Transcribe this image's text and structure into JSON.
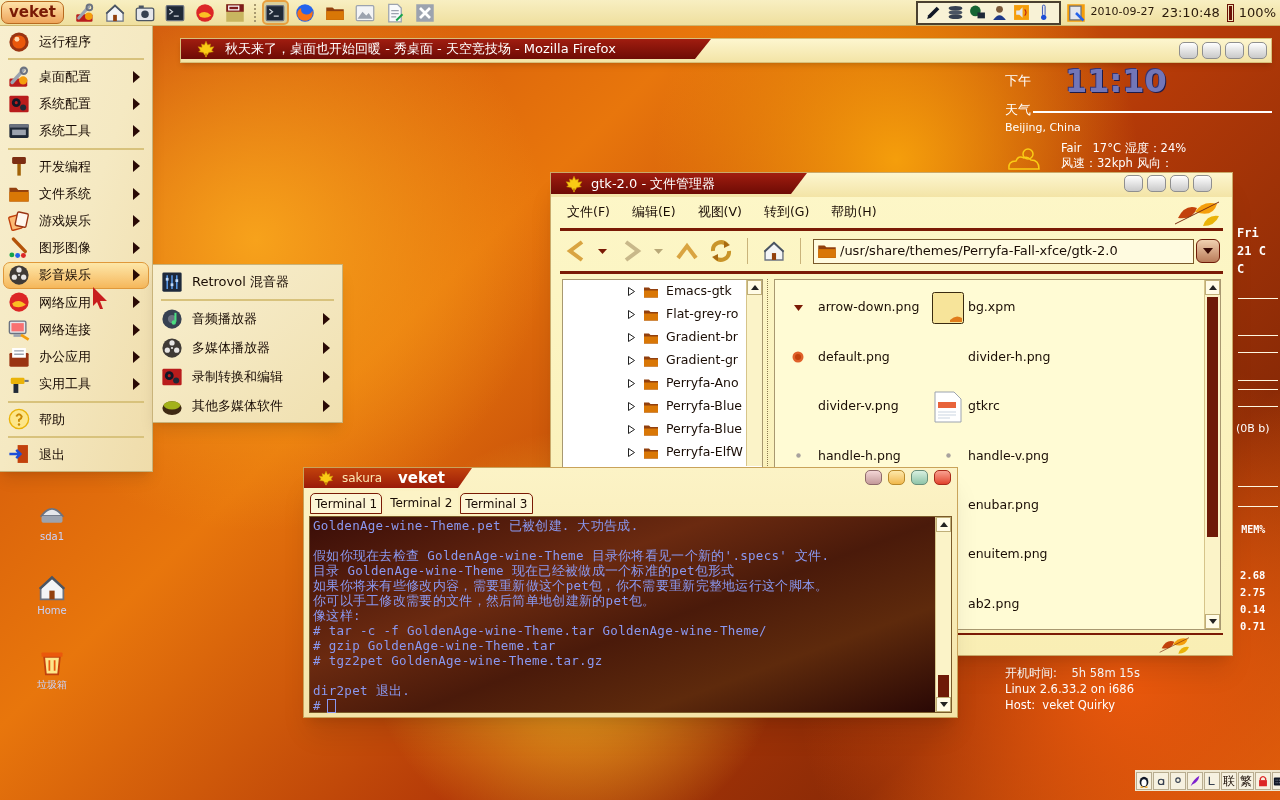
{
  "top_panel": {
    "start_button": "veket",
    "launchers": [
      {
        "active": false
      },
      {
        "active": false
      },
      {
        "active": false
      },
      {
        "active": false
      },
      {
        "active": false
      },
      {
        "active": false
      },
      {
        "active": true
      },
      {
        "active": false
      },
      {
        "active": false
      },
      {
        "active": false
      },
      {
        "active": false
      },
      {
        "active": false
      }
    ],
    "date": "2010-09-27",
    "time": "23:10:48",
    "battery_reading": "100%"
  },
  "browser_window": {
    "title": "秋天来了，桌面也开始回暖 - 秀桌面 - 天空竞技场 - Mozilla Firefox"
  },
  "conky": {
    "period": "下午",
    "clock": "11:10",
    "weather_heading": "天气",
    "location": "Beijing, China",
    "conditions": "Fair   17°C 湿度：24%",
    "wind": "风速：32kph 风向：",
    "forecast": [
      "Fri",
      "21 C",
      "C"
    ],
    "traffic": "(0B b)",
    "mem_heading": "MEM%",
    "mem_values": [
      "2.68",
      "2.75",
      "0.14",
      "0.71"
    ],
    "uptime": "开机时间:    5h 58m 15s",
    "kernel": "Linux 2.6.33.2 on i686",
    "host": "Host:  veket Quirky"
  },
  "menu": {
    "items": [
      {
        "kind": "item",
        "label": "运行程序",
        "submenu": false,
        "selected": false
      },
      {
        "kind": "separator"
      },
      {
        "kind": "item",
        "label": "桌面配置",
        "submenu": true,
        "selected": false
      },
      {
        "kind": "item",
        "label": "系统配置",
        "submenu": true,
        "selected": false
      },
      {
        "kind": "item",
        "label": "系统工具",
        "submenu": true,
        "selected": false
      },
      {
        "kind": "separator"
      },
      {
        "kind": "item",
        "label": "开发编程",
        "submenu": true,
        "selected": false
      },
      {
        "kind": "item",
        "label": "文件系统",
        "submenu": true,
        "selected": false
      },
      {
        "kind": "item",
        "label": "游戏娱乐",
        "submenu": true,
        "selected": false
      },
      {
        "kind": "item",
        "label": "图形图像",
        "submenu": true,
        "selected": false
      },
      {
        "kind": "item",
        "label": "影音娱乐",
        "submenu": true,
        "selected": true
      },
      {
        "kind": "item",
        "label": "网络应用",
        "submenu": true,
        "selected": false
      },
      {
        "kind": "item",
        "label": "网络连接",
        "submenu": true,
        "selected": false
      },
      {
        "kind": "item",
        "label": "办公应用",
        "submenu": true,
        "selected": false
      },
      {
        "kind": "item",
        "label": "实用工具",
        "submenu": true,
        "selected": false
      },
      {
        "kind": "separator"
      },
      {
        "kind": "item",
        "label": "帮助",
        "submenu": false,
        "selected": false
      },
      {
        "kind": "separator"
      },
      {
        "kind": "item",
        "label": "退出",
        "submenu": false,
        "selected": false
      }
    ]
  },
  "submenu": {
    "items": [
      {
        "kind": "item",
        "label": "Retrovol 混音器",
        "submenu": false
      },
      {
        "kind": "separator"
      },
      {
        "kind": "item",
        "label": "音频播放器",
        "submenu": true
      },
      {
        "kind": "item",
        "label": "多媒体播放器",
        "submenu": true
      },
      {
        "kind": "item",
        "label": "录制转换和编辑",
        "submenu": true
      },
      {
        "kind": "item",
        "label": "其他多媒体软件",
        "submenu": true
      }
    ]
  },
  "file_manager": {
    "title": "gtk-2.0 - 文件管理器",
    "menus": [
      "文件(F)",
      "编辑(E)",
      "视图(V)",
      "转到(G)",
      "帮助(H)"
    ],
    "location": "/usr/share/themes/Perryfa-Fall-xfce/gtk-2.0",
    "tree": [
      {
        "label": "Emacs-gtk",
        "expanded": false
      },
      {
        "label": "Flat-grey-ro",
        "expanded": false
      },
      {
        "label": "Gradient-br",
        "expanded": false
      },
      {
        "label": "Gradient-gr",
        "expanded": false
      },
      {
        "label": "Perryfa-Ano",
        "expanded": false
      },
      {
        "label": "Perryfa-Blue",
        "expanded": false
      },
      {
        "label": "Perryfa-Blue",
        "expanded": false
      },
      {
        "label": "Perryfa-ElfW",
        "expanded": false
      }
    ],
    "file_rows": [
      {
        "left": "arrow-down.png",
        "right": "bg.xpm"
      },
      {
        "left": "default.png",
        "right": "divider-h.png"
      },
      {
        "left": "divider-v.png",
        "right": "gtkrc"
      },
      {
        "left": "handle-h.png",
        "right": "handle-v.png"
      },
      {
        "right": "enubar.png"
      },
      {
        "right": "enuitem.png"
      },
      {
        "right": "ab2.png"
      }
    ]
  },
  "terminal": {
    "app": "sakura",
    "host": "veket",
    "tabs": [
      {
        "label": "Terminal 1",
        "selected": false
      },
      {
        "label": "Terminal 2",
        "selected": true
      },
      {
        "label": "Terminal 3",
        "selected": false
      }
    ],
    "output": [
      [
        "GoldenAge-wine-Theme.pet 已被创建. 大功告成."
      ],
      [
        "假如你现在去检查 GoldenAge-wine-Theme 目录你将看见一个新的'.specs' 文件.",
        "目录 GoldenAge-wine-Theme 现在已经被做成一个标准的pet包形式",
        "如果你将来有些修改内容，需要重新做这个pet包，你不需要重新完整地运行这个脚本。",
        "你可以手工修改需要的文件，然后简单地创建新的pet包。",
        "像这样:",
        "# tar -c -f GoldenAge-wine-Theme.tar GoldenAge-wine-Theme/",
        "# gzip GoldenAge-wine-Theme.tar",
        "# tgz2pet GoldenAge-wine-Theme.tar.gz"
      ],
      [
        "dir2pet 退出."
      ]
    ],
    "prompt": "#"
  },
  "desktop_icons": [
    {
      "label": "sda1"
    },
    {
      "label": "Home"
    },
    {
      "label": "垃圾箱"
    }
  ],
  "input_tray": {
    "labels": [
      "联",
      "繁"
    ]
  }
}
